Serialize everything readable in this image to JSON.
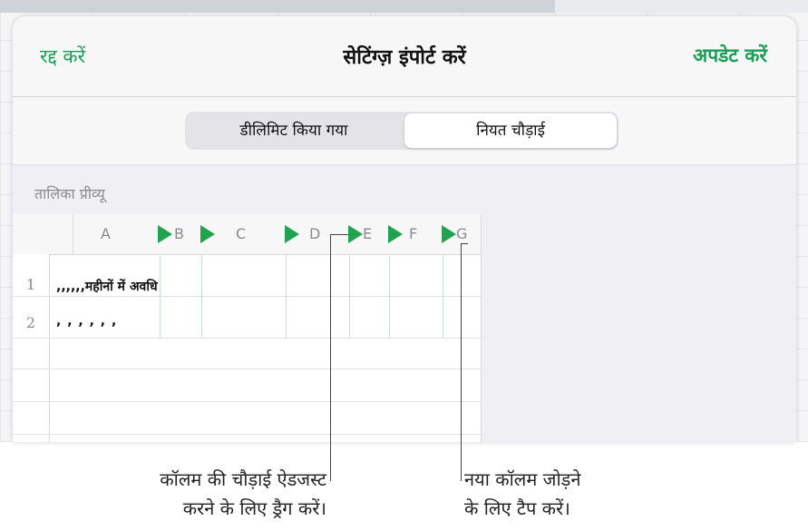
{
  "dialog": {
    "cancel_label": "रद्द करें",
    "title": "सेटिंग्ज़ इंपोर्ट करें",
    "update_label": "अपडेट करें"
  },
  "segments": {
    "delimited": "डीलिमिट किया गया",
    "fixed_width": "नियत चौड़ाई",
    "selected": "fixed_width"
  },
  "preview": {
    "label": "तालिका प्रीव्यू",
    "columns": [
      "A",
      "B",
      "C",
      "D",
      "E",
      "F",
      "G"
    ],
    "rows": [
      {
        "num": "1",
        "text": ",,,,,,महीनों में अवधि"
      },
      {
        "num": "2",
        "text": ", , , , , ,"
      }
    ]
  },
  "callouts": {
    "drag_line1": "कॉलम की चौड़ाई ऐडजस्ट",
    "drag_line2": "करने के लिए ड्रैग करें।",
    "tap_line1": "नया कॉलम जोड़ने",
    "tap_line2": "के लिए टैप करें।"
  },
  "colors": {
    "accent_green": "#1a9f55",
    "marker_green": "#1fa34e"
  }
}
